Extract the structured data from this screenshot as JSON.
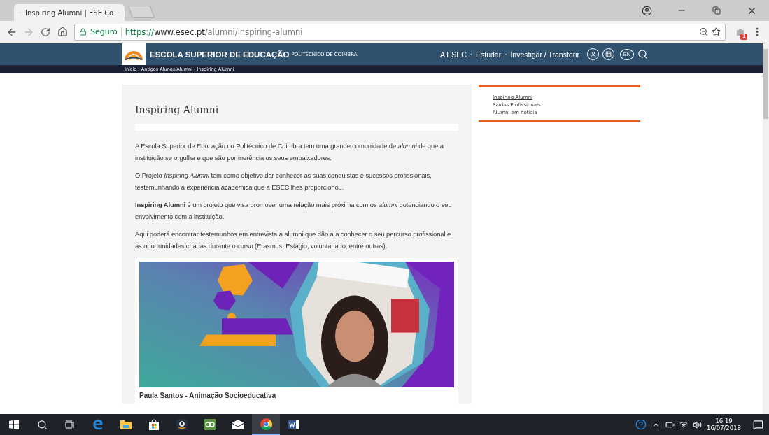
{
  "browser": {
    "tab": {
      "title": "Inspiring Alumni | ESE Co"
    },
    "address": {
      "security": "Seguro",
      "url_scheme": "https://",
      "url_host": "www.esec.pt",
      "url_path": "/alumni/inspiring-alumni"
    },
    "extension_badge": "1"
  },
  "site_header": {
    "title": "ESCOLA SUPERIOR DE EDUCAÇÃO",
    "subtitle": "POLITÉCNICO DE COIMBRA",
    "nav": [
      "A ESEC",
      "Estudar",
      "Investigar / Transferir"
    ],
    "nav_separator": "·",
    "language": "EN"
  },
  "breadcrumb": {
    "items": [
      "Início",
      "Antigos Alunos/Alumni",
      "Inspiring Alumni"
    ],
    "separator": "›"
  },
  "article": {
    "title": "Inspiring Alumni",
    "paragraphs": [
      "A Escola Superior de Educação do Politécnico de Coimbra tem uma grande comunidade de *alumni* de que a instituição se orgulha e que são por inerência os seus embaixadores.",
      "O Projeto *Inspiring Alumni*  tem como objetivo dar conhecer as suas conquistas e sucessos profissionais, testemunhando a experiência académica que a ESEC lhes proporcionou.",
      "**Inspiring Alumni**  é um projeto que visa promover uma relação mais próxima com os *alumni* potenciando o seu envolvimento com a instituição.",
      "Aqui poderá encontrar testemunhos em entrevista a alumni que dão a a conhecer o seu percurso profissional e as oportunidades criadas durante o curso (Erasmus, Estágio, voluntariado, entre outras)."
    ],
    "caption": "Paula Santos - Animação Socioeducativa"
  },
  "sidebar": {
    "links": [
      {
        "label": "Inspiring Alumni",
        "selected": true
      },
      {
        "label": "Saídas Profissionais",
        "selected": false
      },
      {
        "label": "Alumni em notícia",
        "selected": false
      }
    ]
  },
  "taskbar": {
    "apps": [
      {
        "kind": "start",
        "selected": false
      },
      {
        "kind": "search",
        "selected": false
      },
      {
        "kind": "taskview",
        "selected": false
      },
      {
        "kind": "edge",
        "selected": false
      },
      {
        "kind": "explorer",
        "selected": false
      },
      {
        "kind": "store",
        "selected": false
      },
      {
        "kind": "amazon",
        "selected": false
      },
      {
        "kind": "tripadvisor",
        "selected": false
      },
      {
        "kind": "mail",
        "selected": false
      },
      {
        "kind": "chrome",
        "selected": true
      },
      {
        "kind": "word",
        "selected": false
      }
    ],
    "time": "16:19",
    "date": "16/07/2018"
  }
}
